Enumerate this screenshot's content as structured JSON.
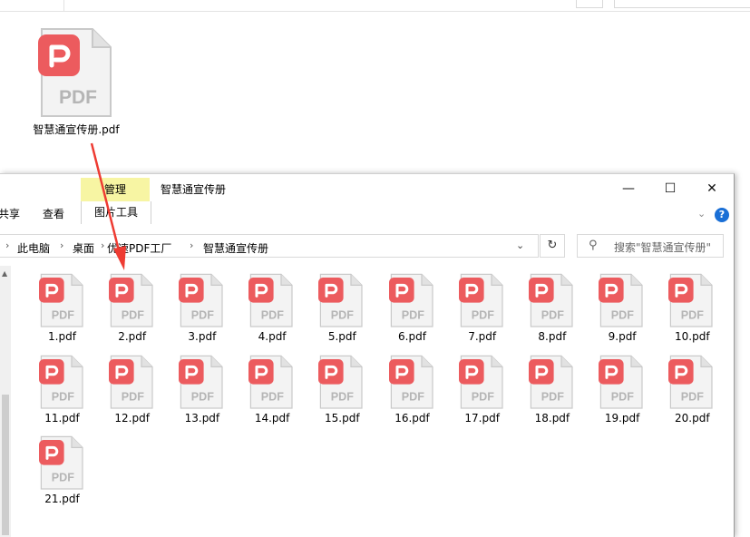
{
  "desktop": {
    "file_label": "智慧通宣传册.pdf"
  },
  "icon_text": "PDF",
  "window": {
    "title": "智慧通宣传册",
    "manage_tab": "管理",
    "controls": {
      "minimize": "—",
      "maximize": "☐",
      "close": "✕"
    }
  },
  "ribbon": {
    "tabs": [
      "共享",
      "查看"
    ],
    "picture_tools": "图片工具",
    "expand_symbol": "⌄",
    "help_symbol": "?"
  },
  "address": {
    "breadcrumbs": [
      "此电脑",
      "桌面",
      "优速PDF工厂",
      "智慧通宣传册"
    ],
    "separator": "›",
    "dropdown_symbol": "⌄",
    "refresh_symbol": "↻"
  },
  "search": {
    "placeholder": "搜索\"智慧通宣传册\"",
    "icon": "⚲"
  },
  "files": [
    "1.pdf",
    "2.pdf",
    "3.pdf",
    "4.pdf",
    "5.pdf",
    "6.pdf",
    "7.pdf",
    "8.pdf",
    "9.pdf",
    "10.pdf",
    "11.pdf",
    "12.pdf",
    "13.pdf",
    "14.pdf",
    "15.pdf",
    "16.pdf",
    "17.pdf",
    "18.pdf",
    "19.pdf",
    "20.pdf",
    "21.pdf"
  ],
  "colors": {
    "pdf_red": "#ec5b5e",
    "manage_tab_bg": "#f7f5a3",
    "arrow_red": "#ee3b32",
    "help_blue": "#1a6fd6"
  }
}
